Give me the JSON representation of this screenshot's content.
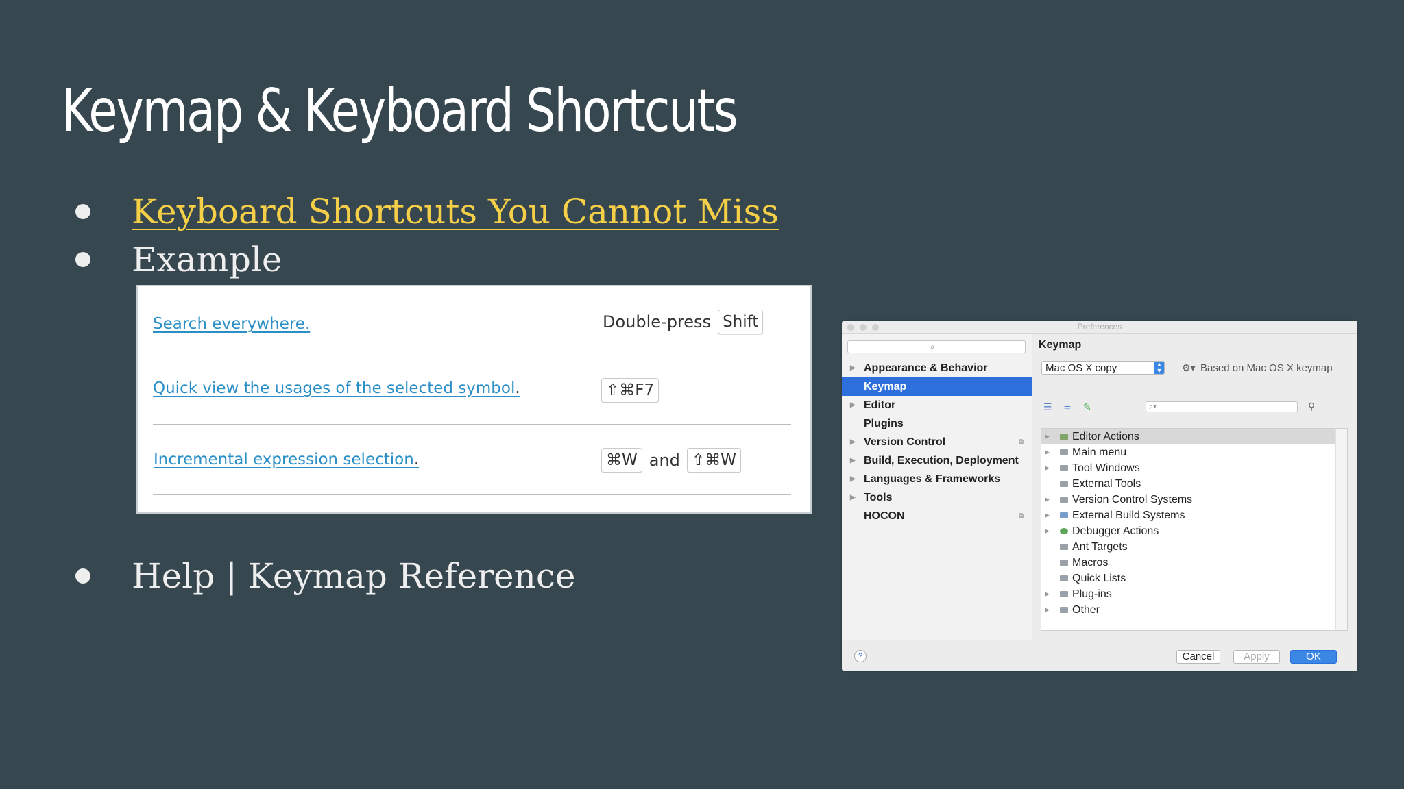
{
  "slide": {
    "title": "Keymap & Keyboard Shortcuts",
    "bullets": {
      "link": "Keyboard Shortcuts You Cannot Miss",
      "example": "Example",
      "help": "Help | Keymap Reference"
    }
  },
  "shortcuts": [
    {
      "action": "Search everywhere.",
      "pre": "Double-press",
      "key1": "Shift",
      "mid": "",
      "key2": ""
    },
    {
      "action": "Quick view the usages of the selected symbol",
      "suffix": ".",
      "key1": "⇧⌘F7"
    },
    {
      "action": "Incremental expression selection",
      "suffix": ".",
      "key1": "⌘W",
      "mid": "and",
      "key2": "⇧⌘W"
    }
  ],
  "prefs": {
    "window_title": "Preferences",
    "nav": [
      {
        "label": "Appearance & Behavior",
        "arrow": "▶"
      },
      {
        "label": "Keymap"
      },
      {
        "label": "Editor",
        "arrow": "▶"
      },
      {
        "label": "Plugins"
      },
      {
        "label": "Version Control",
        "arrow": "▶"
      },
      {
        "label": "Build, Execution, Deployment",
        "arrow": "▶"
      },
      {
        "label": "Languages & Frameworks",
        "arrow": "▶"
      },
      {
        "label": "Tools",
        "arrow": "▶"
      },
      {
        "label": "HOCON"
      }
    ],
    "selected_nav": "Keymap",
    "keymap_heading": "Keymap",
    "keymap_value": "Mac OS X copy",
    "based_on": "Based on Mac OS X keymap",
    "tree": [
      {
        "label": "Editor Actions",
        "expandable": true,
        "highlight": true
      },
      {
        "label": "Main menu",
        "expandable": true
      },
      {
        "label": "Tool Windows",
        "expandable": true
      },
      {
        "label": "External Tools",
        "expandable": false
      },
      {
        "label": "Version Control Systems",
        "expandable": true
      },
      {
        "label": "External Build Systems",
        "expandable": true
      },
      {
        "label": "Debugger Actions",
        "expandable": true
      },
      {
        "label": "Ant Targets",
        "expandable": false
      },
      {
        "label": "Macros",
        "expandable": false
      },
      {
        "label": "Quick Lists",
        "expandable": false
      },
      {
        "label": "Plug-ins",
        "expandable": true
      },
      {
        "label": "Other",
        "expandable": true
      }
    ],
    "buttons": {
      "help": "?",
      "cancel": "Cancel",
      "apply": "Apply",
      "ok": "OK"
    }
  },
  "colors": {
    "background": "#37474f",
    "link": "#f6cf48",
    "selection": "#2c6fdd",
    "shortcut_link": "#2a8fc6"
  }
}
